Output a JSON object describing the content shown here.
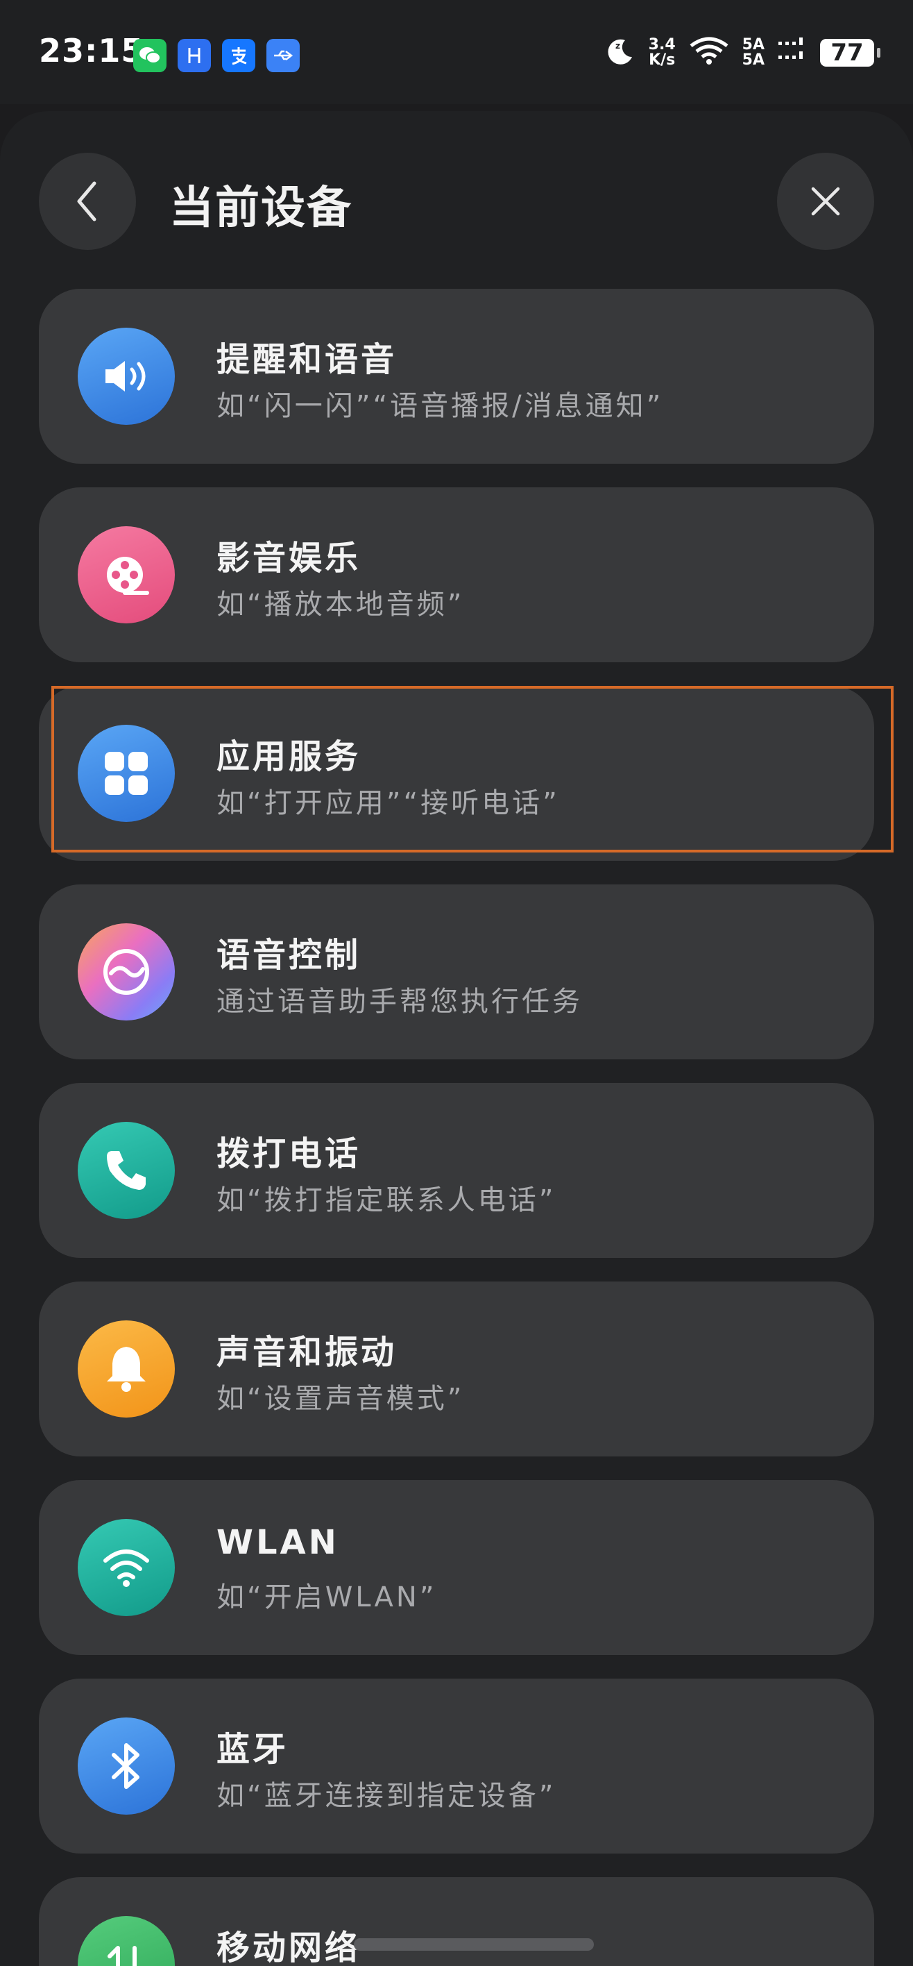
{
  "status_bar": {
    "time": "23:15",
    "speed_value": "3.4",
    "speed_unit": "K/s",
    "sim1": "5A",
    "sim2": "5A",
    "battery": "77"
  },
  "header": {
    "title": "当前设备"
  },
  "cards": [
    {
      "title": "提醒和语音",
      "subtitle": "如“闪一闪”“语音播报/消息通知”",
      "icon": "speaker-icon",
      "color": "#3b8be6"
    },
    {
      "title": "影音娱乐",
      "subtitle": "如“播放本地音频”",
      "icon": "film-reel-icon",
      "color": "#ec5d8a"
    },
    {
      "title": "应用服务",
      "subtitle": "如“打开应用”“接听电话”",
      "icon": "apps-grid-icon",
      "color": "#3b8be6"
    },
    {
      "title": "语音控制",
      "subtitle": "通过语音助手帮您执行任务",
      "icon": "voice-assistant-icon",
      "color": "#b07ee8"
    },
    {
      "title": "拨打电话",
      "subtitle": "如“拨打指定联系人电话”",
      "icon": "phone-icon",
      "color": "#1db3a0"
    },
    {
      "title": "声音和振动",
      "subtitle": "如“设置声音模式”",
      "icon": "bell-icon",
      "color": "#f5a425"
    },
    {
      "title": "WLAN",
      "subtitle": "如“开启WLAN”",
      "icon": "wifi-icon",
      "color": "#1db3a0"
    },
    {
      "title": "蓝牙",
      "subtitle": "如“蓝牙连接到指定设备”",
      "icon": "bluetooth-icon",
      "color": "#3b8be6"
    },
    {
      "title": "移动网络",
      "subtitle": "",
      "icon": "mobile-data-icon",
      "color": "#3cba6a"
    }
  ]
}
